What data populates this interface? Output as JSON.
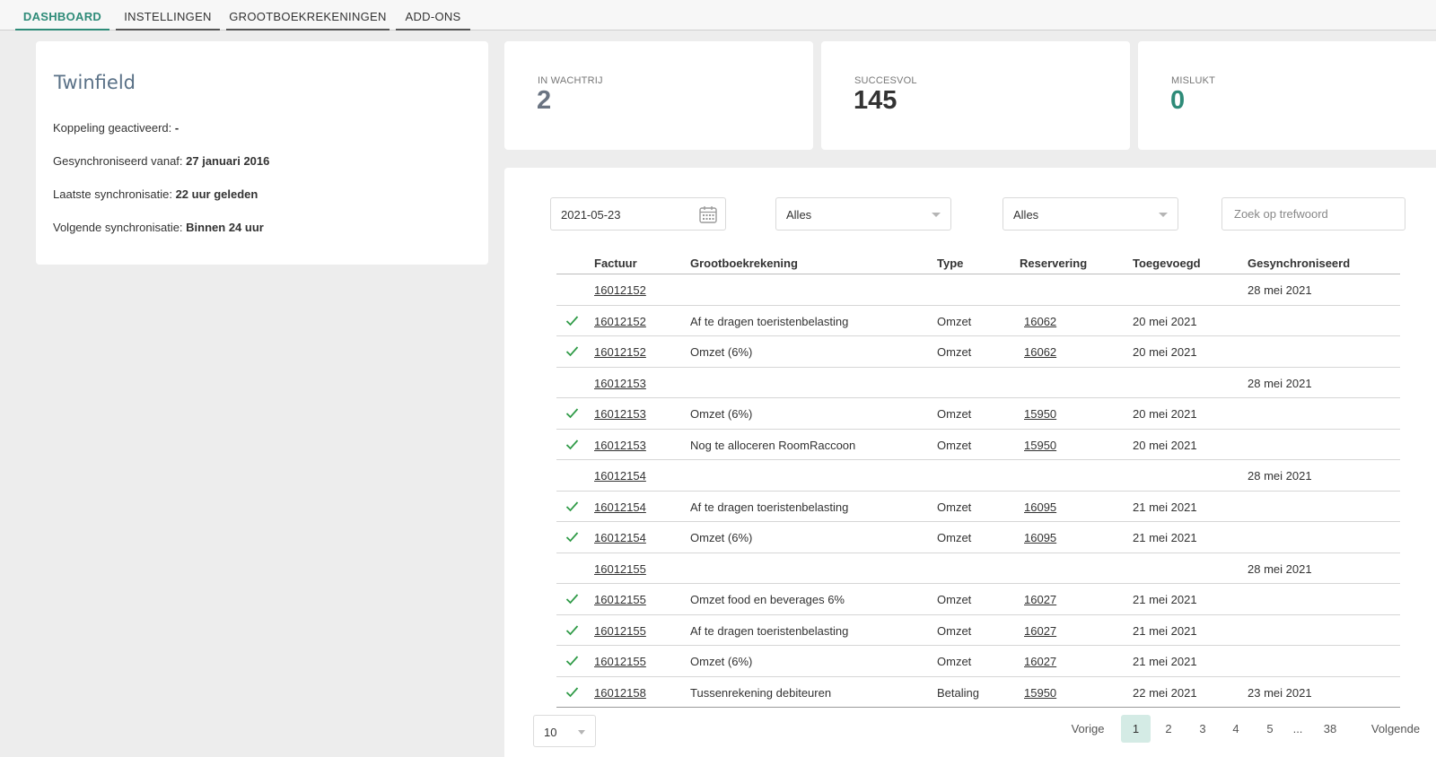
{
  "nav": {
    "tabs": [
      {
        "label": "DASHBOARD"
      },
      {
        "label": "INSTELLINGEN"
      },
      {
        "label": "GROOTBOEKREKENINGEN"
      },
      {
        "label": "ADD-ONS"
      }
    ],
    "active_tab": "DASHBOARD"
  },
  "info": {
    "title": "Twinfield",
    "rows": [
      {
        "label": "Koppeling geactiveerd: ",
        "value": "-"
      },
      {
        "label": "Gesynchroniseerd vanaf: ",
        "value": "27 januari 2016"
      },
      {
        "label": "Laatste synchronisatie: ",
        "value": "22 uur geleden"
      },
      {
        "label": "Volgende synchronisatie: ",
        "value": "Binnen 24 uur"
      }
    ]
  },
  "stats": [
    {
      "label": "IN WACHTRIJ",
      "value": "2",
      "color": "#6a7482"
    },
    {
      "label": "SUCCESVOL",
      "value": "145",
      "color": "#333333"
    },
    {
      "label": "MISLUKT",
      "value": "0",
      "color": "#2e8b78"
    }
  ],
  "filters": {
    "date_value": "2021-05-23",
    "select1_value": "Alles",
    "select2_value": "Alles",
    "search_placeholder": "Zoek op trefwoord"
  },
  "table": {
    "columns": [
      "Factuur",
      "Grootboekrekening",
      "Type",
      "Reservering",
      "Toegevoegd",
      "Gesynchroniseerd"
    ],
    "rows": [
      {
        "check": false,
        "factuur": "16012152",
        "grootboek": "",
        "type": "",
        "reservering": "",
        "toegevoegd": "",
        "gesync": "28 mei 2021"
      },
      {
        "check": true,
        "factuur": "16012152",
        "grootboek": "Af te dragen toeristenbelasting",
        "type": "Omzet",
        "reservering": "16062",
        "toegevoegd": "20 mei 2021",
        "gesync": ""
      },
      {
        "check": true,
        "factuur": "16012152",
        "grootboek": "Omzet (6%)",
        "type": "Omzet",
        "reservering": "16062",
        "toegevoegd": "20 mei 2021",
        "gesync": ""
      },
      {
        "check": false,
        "factuur": "16012153",
        "grootboek": "",
        "type": "",
        "reservering": "",
        "toegevoegd": "",
        "gesync": "28 mei 2021"
      },
      {
        "check": true,
        "factuur": "16012153",
        "grootboek": "Omzet (6%)",
        "type": "Omzet",
        "reservering": "15950",
        "toegevoegd": "20 mei 2021",
        "gesync": ""
      },
      {
        "check": true,
        "factuur": "16012153",
        "grootboek": "Nog te alloceren RoomRaccoon",
        "type": "Omzet",
        "reservering": "15950",
        "toegevoegd": "20 mei 2021",
        "gesync": ""
      },
      {
        "check": false,
        "factuur": "16012154",
        "grootboek": "",
        "type": "",
        "reservering": "",
        "toegevoegd": "",
        "gesync": "28 mei 2021"
      },
      {
        "check": true,
        "factuur": "16012154",
        "grootboek": "Af te dragen toeristenbelasting",
        "type": "Omzet",
        "reservering": "16095",
        "toegevoegd": "21 mei 2021",
        "gesync": ""
      },
      {
        "check": true,
        "factuur": "16012154",
        "grootboek": "Omzet (6%)",
        "type": "Omzet",
        "reservering": "16095",
        "toegevoegd": "21 mei 2021",
        "gesync": ""
      },
      {
        "check": false,
        "factuur": "16012155",
        "grootboek": "",
        "type": "",
        "reservering": "",
        "toegevoegd": "",
        "gesync": "28 mei 2021"
      },
      {
        "check": true,
        "factuur": "16012155",
        "grootboek": "Omzet food en beverages 6%",
        "type": "Omzet",
        "reservering": "16027",
        "toegevoegd": "21 mei 2021",
        "gesync": ""
      },
      {
        "check": true,
        "factuur": "16012155",
        "grootboek": "Af te dragen toeristenbelasting",
        "type": "Omzet",
        "reservering": "16027",
        "toegevoegd": "21 mei 2021",
        "gesync": ""
      },
      {
        "check": true,
        "factuur": "16012155",
        "grootboek": "Omzet (6%)",
        "type": "Omzet",
        "reservering": "16027",
        "toegevoegd": "21 mei 2021",
        "gesync": ""
      },
      {
        "check": true,
        "factuur": "16012158",
        "grootboek": "Tussenrekening debiteuren",
        "type": "Betaling",
        "reservering": "15950",
        "toegevoegd": "22 mei 2021",
        "gesync": "23 mei 2021"
      }
    ]
  },
  "pagination": {
    "per_page": "10",
    "prev_label": "Vorige",
    "next_label": "Volgende",
    "pages": [
      "1",
      "2",
      "3",
      "4",
      "5",
      "...",
      "38"
    ],
    "current": "1"
  },
  "colors": {
    "accent": "#2e8b78",
    "check": "#2e9a46",
    "active_page_bg": "#d4ebe5"
  }
}
